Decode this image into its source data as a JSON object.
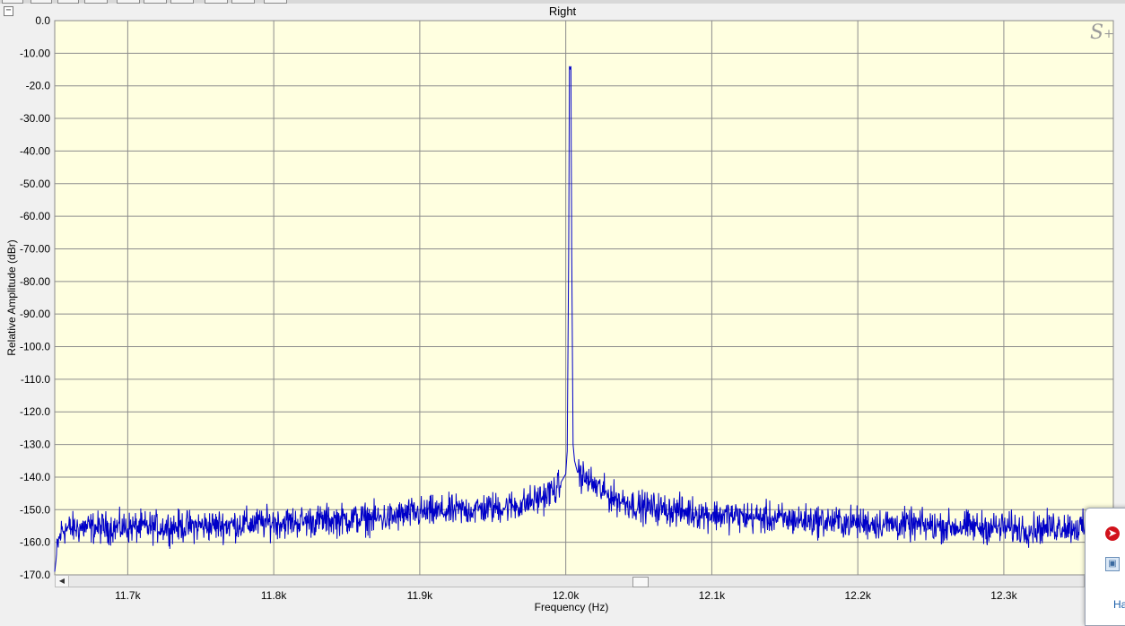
{
  "window": {
    "collapse_symbol": "−"
  },
  "chart_data": {
    "type": "line",
    "title": "Right",
    "xlabel": "Frequency (Hz)",
    "ylabel": "Relative Amplitude (dBr)",
    "xlim": [
      11650,
      12375
    ],
    "ylim": [
      -170,
      0
    ],
    "x_ticks": [
      11700,
      11800,
      11900,
      12000,
      12100,
      12200,
      12300
    ],
    "x_tick_labels": [
      "11.7k",
      "11.8k",
      "11.9k",
      "12.0k",
      "12.1k",
      "12.2k",
      "12.3k"
    ],
    "y_ticks": [
      0,
      -10,
      -20,
      -30,
      -40,
      -50,
      -60,
      -70,
      -80,
      -90,
      -100,
      -110,
      -120,
      -130,
      -140,
      -150,
      -160,
      -170
    ],
    "y_tick_labels": [
      "0.0",
      "-10.00",
      "-20.0",
      "-30.00",
      "-40.00",
      "-50.00",
      "-60.00",
      "-70.00",
      "-80.00",
      "-90.00",
      "-100.0",
      "-110.0",
      "-120.0",
      "-130.0",
      "-140.0",
      "-150.0",
      "-160.0",
      "-170.0"
    ],
    "grid": true,
    "series": [
      {
        "color": "#0000c8",
        "x": [
          11650,
          11652,
          11655,
          11670,
          11700,
          11750,
          11800,
          11850,
          11880,
          11890,
          11900,
          11920,
          11950,
          11970,
          11985,
          11995,
          12000,
          12001,
          12002,
          12002.5,
          12003,
          12003.5,
          12004,
          12005,
          12006,
          12008,
          12015,
          12030,
          12050,
          12080,
          12100,
          12150,
          12200,
          12250,
          12300,
          12320,
          12340,
          12360,
          12375
        ],
        "y": [
          -169,
          -161,
          -156,
          -155.5,
          -155.5,
          -155,
          -154,
          -153,
          -152.5,
          -151.5,
          -151,
          -150.5,
          -149.5,
          -148.5,
          -146,
          -143,
          -139,
          -132,
          -70,
          -14,
          -15,
          -14,
          -65,
          -130,
          -135,
          -138.5,
          -141,
          -146,
          -149,
          -150.5,
          -151.5,
          -153,
          -154,
          -155,
          -155.5,
          -156,
          -155,
          -156,
          -157
        ]
      }
    ]
  },
  "noise": {
    "amplitude_db": 2.4,
    "samples": 2400
  },
  "logo": {
    "text": "S",
    "sub": "+"
  },
  "scrollbar": {
    "left_arrow": "◀",
    "thumb_position": 0.56
  },
  "popup": {
    "link_text": "Ha",
    "icon_red": "red-arrow-icon",
    "icon_app": "app-window-icon"
  }
}
